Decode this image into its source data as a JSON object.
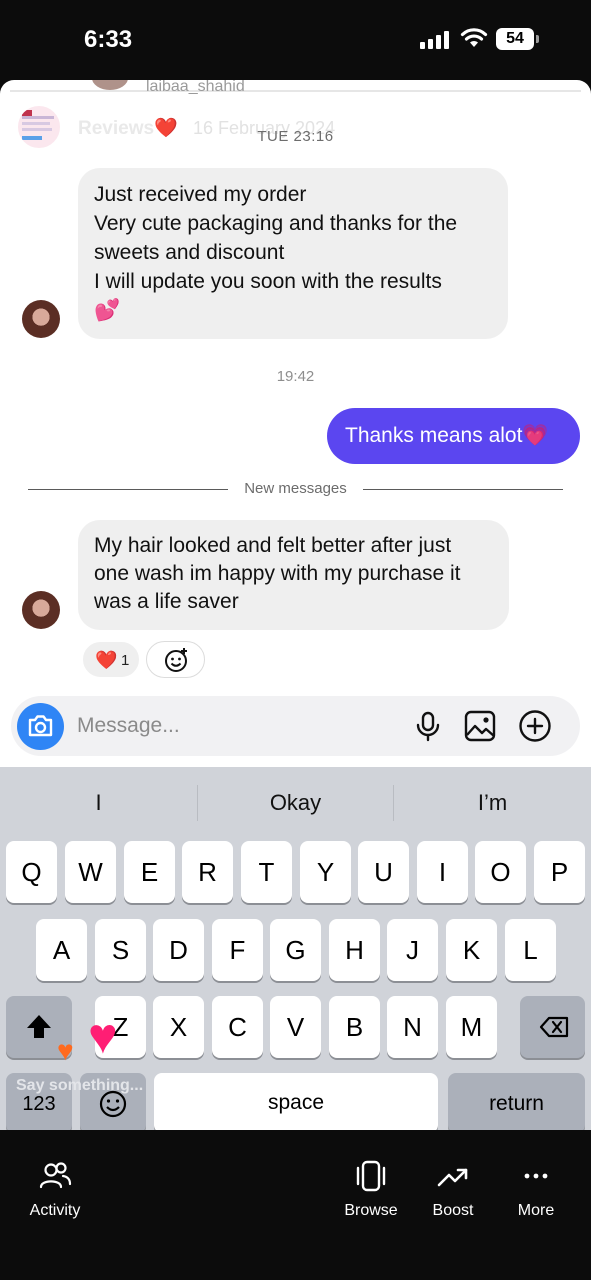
{
  "status_bar": {
    "time": "6:33",
    "battery": "54"
  },
  "story": {
    "ghost_username": "laibaa_shahid",
    "title": "Reviews❤️",
    "date": "16 February 2024"
  },
  "chat": {
    "first_timestamp": "TUE 23:16",
    "message_1_lines": [
      "Just received my order",
      "Very cute packaging and thanks for the",
      "sweets and discount",
      "I will update you soon with the results",
      "💕"
    ],
    "second_timestamp": "19:42",
    "outgoing_message": "Thanks means alot💗",
    "divider_label": "New messages",
    "message_2_lines": [
      "My hair looked and felt better after just",
      "one wash im happy with my purchase it",
      "was a life saver"
    ],
    "reaction_emoji": "❤️",
    "reaction_count": "1"
  },
  "composer": {
    "placeholder": "Message..."
  },
  "keyboard": {
    "suggestions": [
      "I",
      "Okay",
      "I’m"
    ],
    "row1": [
      "Q",
      "W",
      "E",
      "R",
      "T",
      "Y",
      "U",
      "I",
      "O",
      "P"
    ],
    "row2": [
      "A",
      "S",
      "D",
      "F",
      "G",
      "H",
      "J",
      "K",
      "L"
    ],
    "row3": [
      "Z",
      "X",
      "C",
      "V",
      "B",
      "N",
      "M"
    ],
    "numbers_label": "123",
    "space_label": "space",
    "return_label": "return",
    "ghost_placeholder": "Say something..."
  },
  "bottom_nav": {
    "items": [
      {
        "label": "Activity",
        "icon": "people-icon"
      },
      {
        "label": "Browse",
        "icon": "browse-icon"
      },
      {
        "label": "Boost",
        "icon": "trend-up-icon"
      },
      {
        "label": "More",
        "icon": "more-icon"
      }
    ]
  },
  "colors": {
    "outgoing_bubble": "#5b46f0",
    "incoming_bubble": "#efefef",
    "camera_button": "#2f85f5",
    "keyboard_bg": "#d0d3d9"
  }
}
